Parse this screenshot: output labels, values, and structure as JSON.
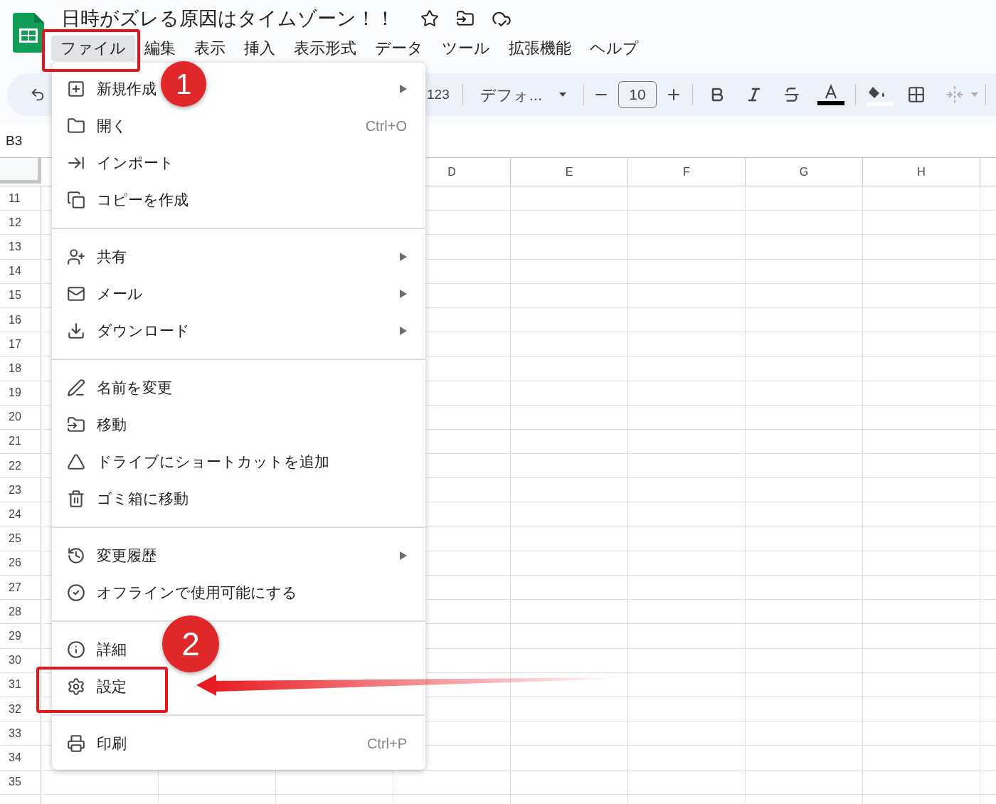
{
  "document": {
    "title": "日時がズレる原因はタイムゾーン！！"
  },
  "menu_bar": [
    {
      "label": "ファイル",
      "selected": true
    },
    {
      "label": "編集",
      "selected": false
    },
    {
      "label": "表示",
      "selected": false
    },
    {
      "label": "挿入",
      "selected": false
    },
    {
      "label": "表示形式",
      "selected": false
    },
    {
      "label": "データ",
      "selected": false
    },
    {
      "label": "ツール",
      "selected": false
    },
    {
      "label": "拡張機能",
      "selected": false
    },
    {
      "label": "ヘルプ",
      "selected": false
    }
  ],
  "toolbar": {
    "number_format": "123",
    "font": "デフォ...",
    "font_size": "10"
  },
  "name_box": "B3",
  "columns": [
    "D",
    "E",
    "F",
    "G",
    "H"
  ],
  "rows": [
    "11",
    "12",
    "13",
    "14",
    "15",
    "16",
    "17",
    "18",
    "19",
    "20",
    "21",
    "22",
    "23",
    "24",
    "25",
    "26",
    "27",
    "28",
    "29",
    "30",
    "31",
    "32",
    "33",
    "34",
    "35"
  ],
  "file_menu": [
    [
      {
        "label": "新規作成",
        "has_submenu": true
      },
      {
        "label": "開く",
        "shortcut": "Ctrl+O",
        "has_submenu": false
      },
      {
        "label": "インポート",
        "has_submenu": false
      },
      {
        "label": "コピーを作成",
        "has_submenu": false
      }
    ],
    [
      {
        "label": "共有",
        "has_submenu": true
      },
      {
        "label": "メール",
        "has_submenu": true
      },
      {
        "label": "ダウンロード",
        "has_submenu": true
      }
    ],
    [
      {
        "label": "名前を変更",
        "has_submenu": false
      },
      {
        "label": "移動",
        "has_submenu": false
      },
      {
        "label": "ドライブにショートカットを追加",
        "has_submenu": false
      },
      {
        "label": "ゴミ箱に移動",
        "has_submenu": false
      }
    ],
    [
      {
        "label": "変更履歴",
        "has_submenu": true
      },
      {
        "label": "オフラインで使用可能にする",
        "has_submenu": false
      }
    ],
    [
      {
        "label": "詳細",
        "has_submenu": false
      },
      {
        "label": "設定",
        "has_submenu": false
      }
    ],
    [
      {
        "label": "印刷",
        "shortcut": "Ctrl+P",
        "has_submenu": false
      }
    ]
  ],
  "annotations": [
    {
      "label": "1"
    },
    {
      "label": "2"
    }
  ]
}
